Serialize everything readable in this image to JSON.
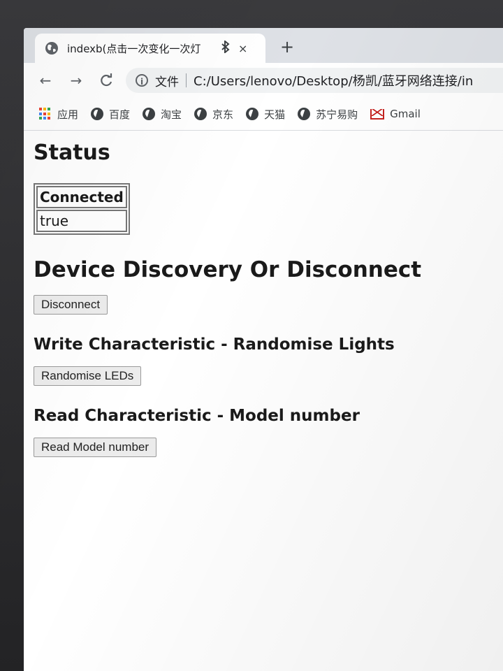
{
  "browser": {
    "tab": {
      "title": "indexb(点击一次变化一次灯",
      "favicon": "globe-icon",
      "bluetooth_icon": "bluetooth-icon",
      "close_glyph": "×"
    },
    "new_tab_glyph": "+",
    "toolbar": {
      "back_glyph": "←",
      "forward_glyph": "→",
      "reload_glyph": "C",
      "info_glyph": "i",
      "scheme_label": "文件",
      "url": "C:/Users/lenovo/Desktop/杨凯/蓝牙网络连接/in"
    },
    "bookmarks": [
      {
        "label": "应用",
        "icon": "apps-icon"
      },
      {
        "label": "百度",
        "icon": "globe-icon"
      },
      {
        "label": "淘宝",
        "icon": "globe-icon"
      },
      {
        "label": "京东",
        "icon": "globe-icon"
      },
      {
        "label": "天猫",
        "icon": "globe-icon"
      },
      {
        "label": "苏宁易购",
        "icon": "globe-icon"
      },
      {
        "label": "Gmail",
        "icon": "gmail-icon"
      }
    ]
  },
  "page": {
    "status_heading": "Status",
    "status_table": {
      "header": "Connected",
      "value": "true"
    },
    "discovery_heading": "Device Discovery Or Disconnect",
    "disconnect_button": "Disconnect",
    "write_heading": "Write Characteristic - Randomise Lights",
    "randomise_button": "Randomise LEDs",
    "read_heading": "Read Characteristic - Model number",
    "read_model_button": "Read Model number"
  }
}
